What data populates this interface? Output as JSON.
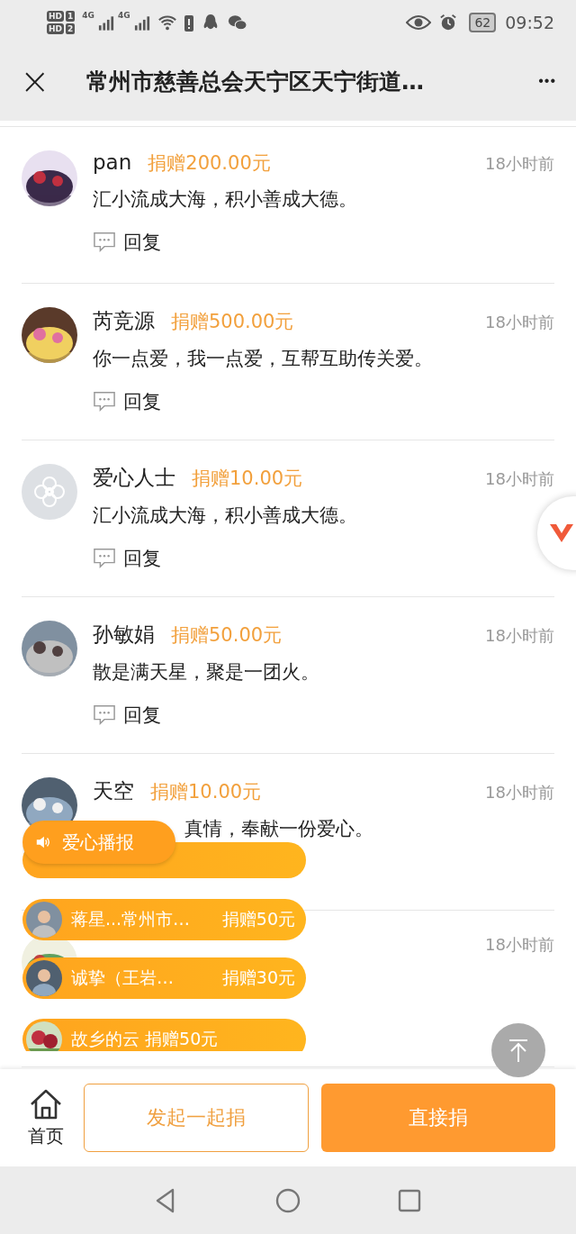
{
  "status_bar": {
    "sims": [
      {
        "badge": "HD",
        "slot": "1"
      },
      {
        "badge": "HD",
        "slot": "2"
      }
    ],
    "networks": [
      "4G",
      "4G"
    ],
    "battery": "62",
    "time": "09:52"
  },
  "title_bar": {
    "close": "×",
    "title": "常州市慈善总会天宁区天宁街道…",
    "more": "•••"
  },
  "donations": [
    {
      "name": "pan",
      "amount": "捐赠200.00元",
      "time": "18小时前",
      "message": "汇小流成大海，积小善成大德。",
      "reply": "回复"
    },
    {
      "name": "芮竞源",
      "amount": "捐赠500.00元",
      "time": "18小时前",
      "message": "你一点爱，我一点爱，互帮互助传关爱。",
      "reply": "回复"
    },
    {
      "kind": "default_avatar",
      "name": "爱心人士",
      "amount": "捐赠10.00元",
      "time": "18小时前",
      "message": "汇小流成大海，积小善成大德。",
      "reply": "回复"
    },
    {
      "name": "孙敏娟",
      "amount": "捐赠50.00元",
      "time": "18小时前",
      "message": "散是满天星，聚是一团火。",
      "reply": "回复"
    },
    {
      "name": "天空",
      "amount": "捐赠10.00元",
      "time": "18小时前",
      "message": "真情，奉献一份爱心。"
    },
    {
      "time": "18小时前"
    }
  ],
  "broadcast": {
    "label": "爱心播报",
    "items": [
      {
        "kind": "strip"
      },
      {
        "kind": "split",
        "name": "蒋星...常州市…",
        "amount": "捐赠50元"
      },
      {
        "kind": "split",
        "name": "诚挚（王岩…",
        "amount": "捐赠30元"
      },
      {
        "kind": "single",
        "text": "故乡的云 捐赠50元"
      }
    ]
  },
  "bottom_bar": {
    "home": "首页",
    "start_button": "发起一起捐",
    "donate_button": "直接捐"
  }
}
